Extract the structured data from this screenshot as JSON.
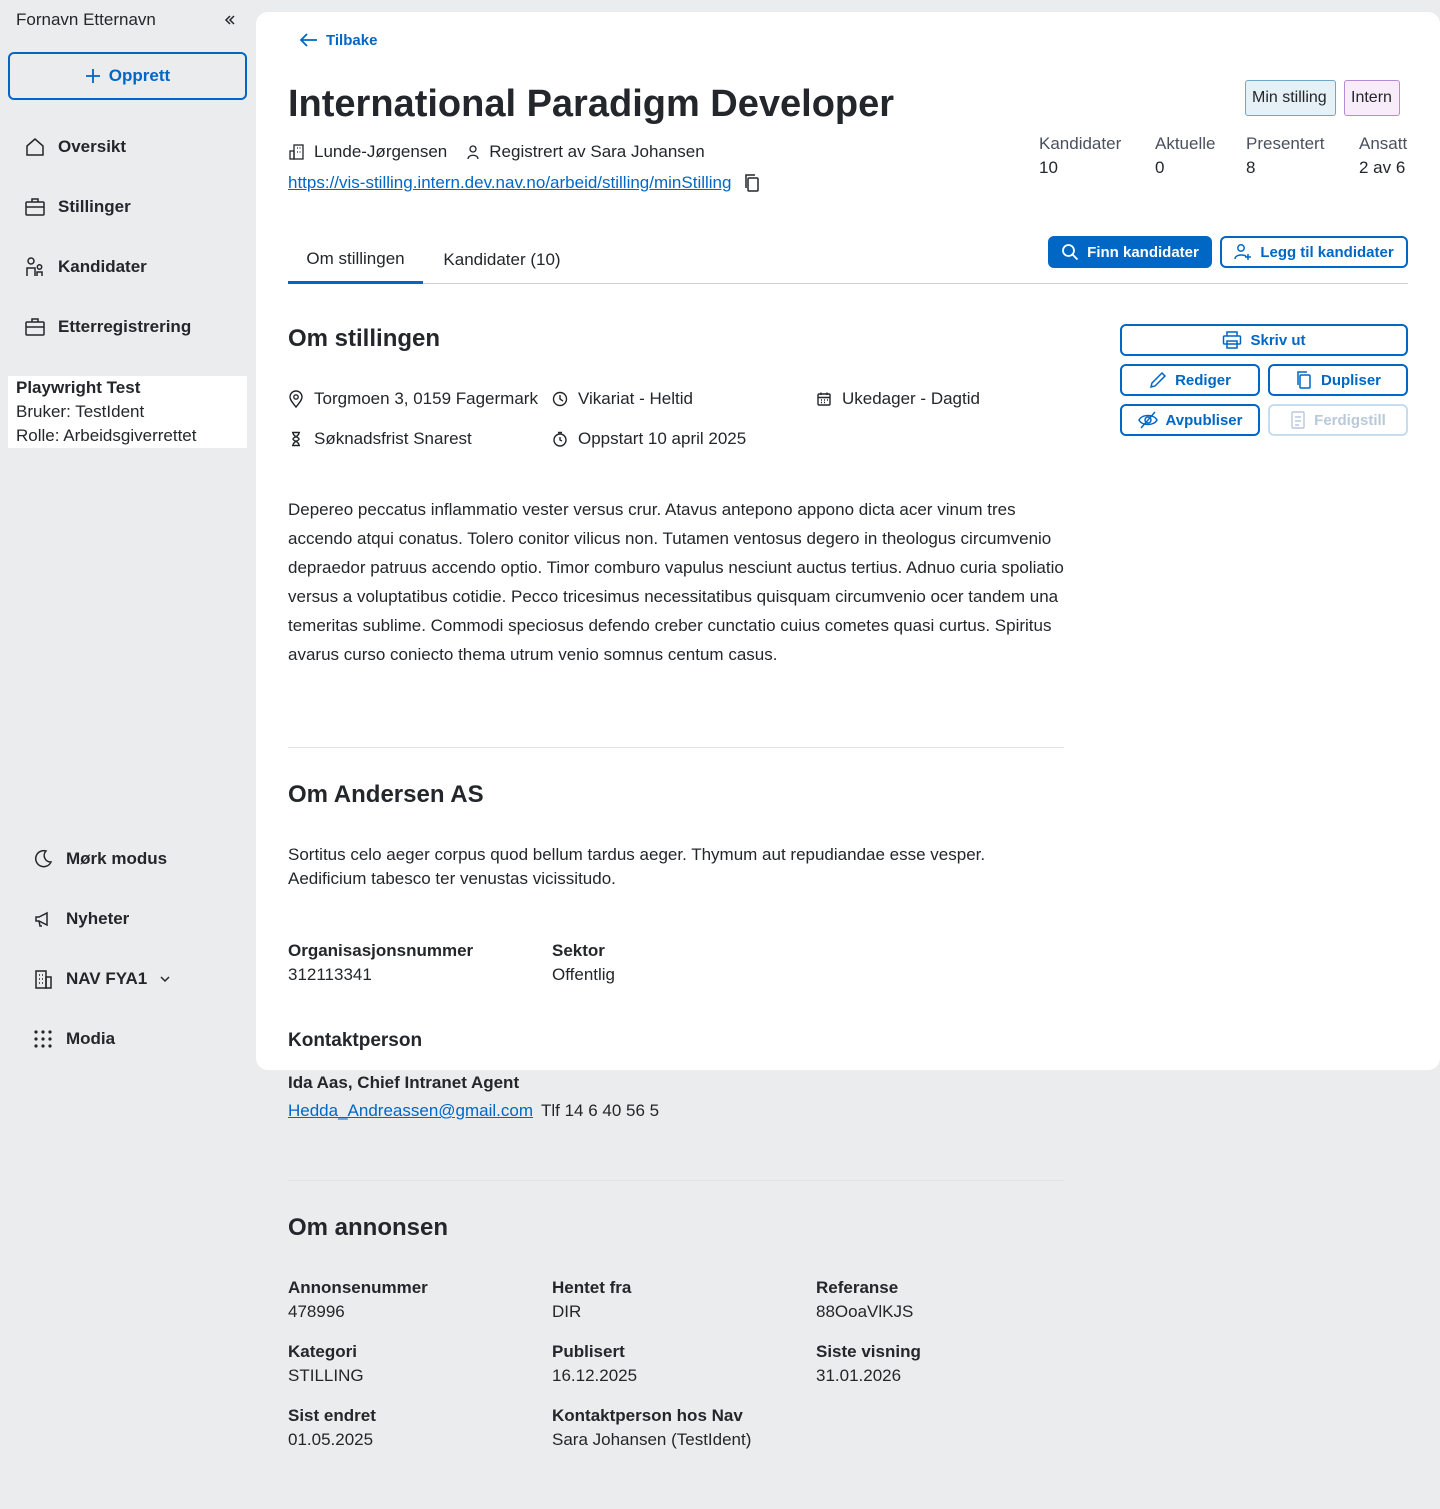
{
  "sidebar": {
    "user_name": "Fornavn Etternavn",
    "create_label": "Opprett",
    "nav": [
      "Oversikt",
      "Stillinger",
      "Kandidater",
      "Etterregistrering"
    ],
    "test_box": {
      "title": "Playwright Test",
      "user": "Bruker: TestIdent",
      "role": "Rolle: Arbeidsgiverrettet"
    },
    "bottom": [
      "Mørk modus",
      "Nyheter",
      "NAV FYA1",
      "Modia"
    ]
  },
  "header": {
    "back_label": "Tilbake",
    "title": "International Paradigm Developer",
    "tags": [
      "Min stilling",
      "Intern"
    ],
    "employer": "Lunde-Jørgensen",
    "registered_by": "Registrert av Sara Johansen",
    "url": "https://vis-stilling.intern.dev.nav.no/arbeid/stilling/minStilling",
    "stats": [
      {
        "label": "Kandidater",
        "value": "10"
      },
      {
        "label": "Aktuelle",
        "value": "0"
      },
      {
        "label": "Presentert",
        "value": "8"
      },
      {
        "label": "Ansatt",
        "value": "2 av 6"
      }
    ]
  },
  "tabs": [
    "Om stillingen",
    "Kandidater (10)"
  ],
  "actions": {
    "find": "Finn kandidater",
    "add": "Legg til kandidater",
    "print": "Skriv ut",
    "edit": "Rediger",
    "duplicate": "Dupliser",
    "unpublish": "Avpubliser",
    "complete": "Ferdigstill"
  },
  "about_job": {
    "heading": "Om stillingen",
    "location": "Torgmoen 3, 0159 Fagermark",
    "type": "Vikariat - Heltid",
    "schedule": "Ukedager - Dagtid",
    "deadline": "Søknadsfrist Snarest",
    "start": "Oppstart 10 april 2025",
    "description": "Depereo peccatus inflammatio vester versus crur. Atavus antepono appono dicta acer vinum tres accendo atqui conatus. Tolero conitor vilicus non. Tutamen ventosus degero in theologus circumvenio depraedor patruus accendo optio. Timor comburo vapulus nesciunt auctus tertius. Adnuo curia spoliatio versus a voluptatibus cotidie. Pecco tricesimus necessitatibus quisquam circumvenio ocer tandem una temeritas sublime. Commodi speciosus defendo creber cunctatio cuius cometes quasi curtus. Spiritus avarus curso coniecto thema utrum venio somnus centum casus."
  },
  "about_employer": {
    "heading": "Om Andersen AS",
    "description": "Sortitus celo aeger corpus quod bellum tardus aeger. Thymum aut repudiandae esse vesper. Aedificium tabesco ter venustas vicissitudo.",
    "org_label": "Organisasjonsnummer",
    "org_value": "312113341",
    "sector_label": "Sektor",
    "sector_value": "Offentlig",
    "contact_heading": "Kontaktperson",
    "contact_name": "Ida Aas, Chief Intranet Agent",
    "contact_email": "Hedda_Andreassen@gmail.com",
    "contact_phone": "Tlf 14 6 40 56 5"
  },
  "about_ad": {
    "heading": "Om annonsen",
    "fields": [
      {
        "label": "Annonsenummer",
        "value": "478996"
      },
      {
        "label": "Hentet fra",
        "value": "DIR"
      },
      {
        "label": "Referanse",
        "value": "88OoaVlKJS"
      },
      {
        "label": "Kategori",
        "value": "STILLING"
      },
      {
        "label": "Publisert",
        "value": "16.12.2025"
      },
      {
        "label": "Siste visning",
        "value": "31.01.2026"
      },
      {
        "label": "Sist endret",
        "value": "01.05.2025"
      },
      {
        "label": "Kontaktperson hos Nav",
        "value": "Sara Johansen (TestIdent)"
      }
    ]
  },
  "colors": {
    "accent": "#0067c5",
    "page_bg": "#ebecee",
    "text": "#23262a"
  }
}
